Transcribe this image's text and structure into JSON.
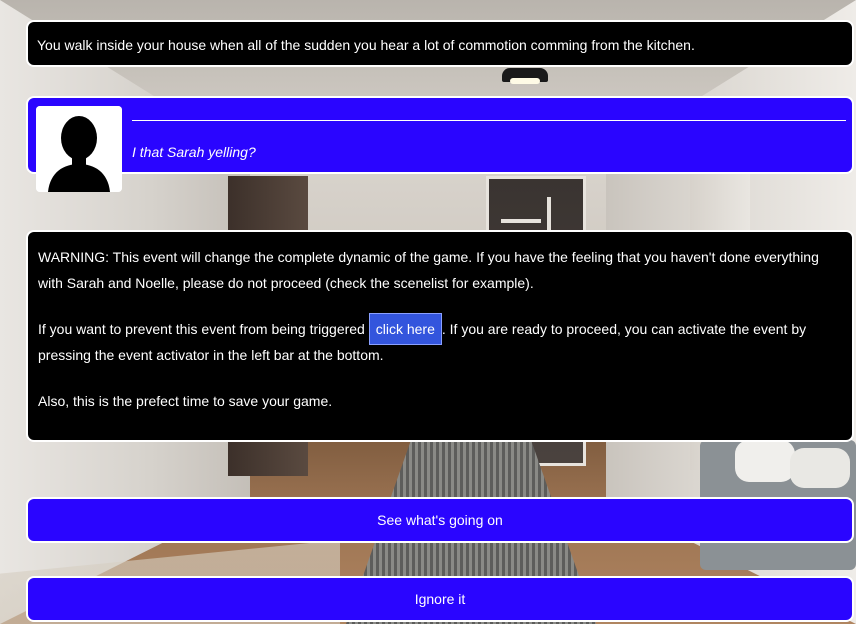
{
  "narration": "You walk inside your house when all of the sudden you hear a lot of commotion comming from the kitchen.",
  "dialog": {
    "speaker_avatar_icon": "silhouette-avatar-icon",
    "line": "I that Sarah yelling?"
  },
  "warning": {
    "p1": "WARNING: This event will change the complete dynamic of the game. If you have the feeling that you haven't done everything with Sarah and Noelle, please do not proceed (check the scenelist for example).",
    "p2_before": "If you want to prevent this event from being triggered",
    "p2_link": "click here",
    "p2_after": ". If you are ready to proceed, you can activate the event by pressing the event activator in the left bar at the bottom.",
    "p3": "Also, this is the prefect time to save your game."
  },
  "choices": [
    "See what's going on",
    "Ignore it"
  ],
  "colors": {
    "dialog_bg": "#2a05ff",
    "text_box_bg": "#000000",
    "link_bg": "#3355dd"
  }
}
